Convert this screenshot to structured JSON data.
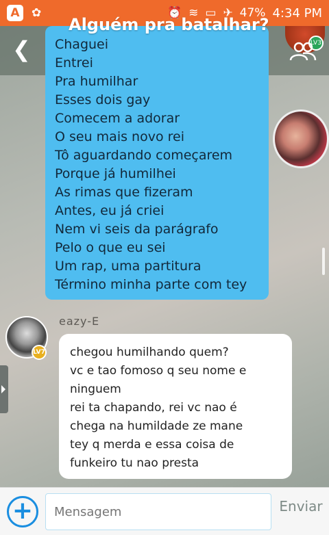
{
  "status_bar": {
    "app_letter": "A",
    "battery": "47%",
    "time": "4:34 PM",
    "icons": [
      "alarm-icon",
      "wifi-icon",
      "sd-card-icon",
      "airplane-icon",
      "battery-icon"
    ]
  },
  "header": {
    "title": "Alguém pra batalhar?",
    "back_icon": "chevron-left-icon",
    "group_icon": "group-icon",
    "level_badge": "LV3"
  },
  "messages": [
    {
      "lines": [
        "Chaguei",
        "Entrei",
        "Pra humilhar",
        "Esses dois gay",
        "Comecem a adorar",
        "O seu mais novo rei",
        "Tô aguardando começarem",
        "Porque já humilhei",
        "As rimas que fizeram",
        "Antes, eu já criei",
        "Nem vi seis da parágrafo",
        "Pelo o que eu sei",
        "Um rap, uma partitura",
        "Término minha parte com tey"
      ]
    },
    {
      "username": "eazy-E",
      "level": "LV7",
      "lines": [
        "chegou humilhando quem?",
        "vc e tao fomoso q seu nome e",
        "ninguem",
        "rei ta  chapando, rei vc nao é",
        "chega na humildade ze mane",
        "tey q merda e essa coisa de",
        "funkeiro tu nao presta"
      ]
    }
  ],
  "composer": {
    "placeholder": "Mensagem",
    "send_label": "Enviar"
  },
  "colors": {
    "status_bar": "#ef6a2b",
    "own_bubble": "#4fbdf0",
    "other_bubble": "#ffffff",
    "accent": "#1a8ee0"
  }
}
